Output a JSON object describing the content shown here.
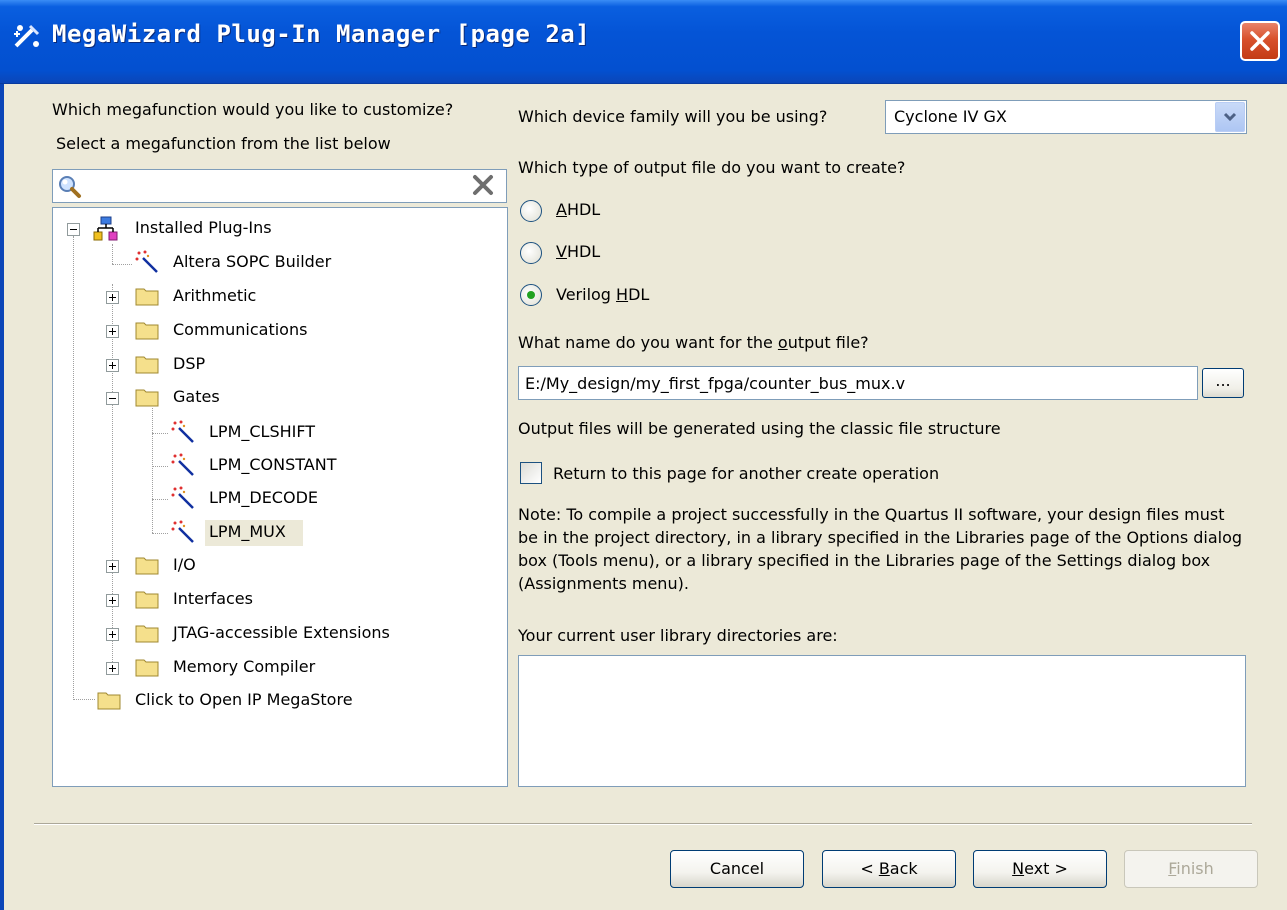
{
  "window": {
    "title": "MegaWizard Plug-In Manager [page 2a]"
  },
  "left": {
    "question": "Which megafunction would you like to customize?",
    "instruction": "Select a megafunction from the list below",
    "search_placeholder": "",
    "tree": {
      "root": "Installed Plug-Ins",
      "items": [
        "Altera SOPC Builder",
        "Arithmetic",
        "Communications",
        "DSP",
        "Gates",
        "LPM_CLSHIFT",
        "LPM_CONSTANT",
        "LPM_DECODE",
        "LPM_MUX",
        "I/O",
        "Interfaces",
        "JTAG-accessible Extensions",
        "Memory Compiler",
        "Click to Open IP MegaStore"
      ],
      "selected": "LPM_MUX"
    }
  },
  "right": {
    "device_question": "Which device family will you be using?",
    "device_value": "Cyclone IV GX",
    "output_type_question": "Which type of output file do you want to create?",
    "radio_options": {
      "ahdl_first": "A",
      "ahdl_rest": "HDL",
      "vhdl_first": "V",
      "vhdl_rest": "HDL",
      "verilog_pre": "Verilog ",
      "verilog_key": "H",
      "verilog_rest": "DL"
    },
    "selected_output": "Verilog HDL",
    "name_question_pre": "What name do you want for the ",
    "name_question_key": "o",
    "name_question_rest": "utput file?",
    "output_file_value": "E:/My_design/my_first_fpga/counter_bus_mux.v",
    "browse_label": "...",
    "structure_note": "Output files will be generated using the classic file structure",
    "return_checkbox_label": "Return to this page for another create operation",
    "return_checked": false,
    "note": "Note: To compile a project successfully in the Quartus II software, your design files must be in the project directory, in a library specified in the Libraries page of the Options dialog box (Tools menu), or a library specified in the Libraries page of the Settings dialog box (Assignments menu).",
    "library_label": "Your current user library directories are:"
  },
  "buttons": {
    "cancel": "Cancel",
    "back_pre": "< ",
    "back_key": "B",
    "back_rest": "ack",
    "next_key": "N",
    "next_rest": "ext >",
    "finish_key": "F",
    "finish_rest": "inish"
  },
  "colors": {
    "title_bar": "#0454d6",
    "dialog_bg": "#ece9d8",
    "radio_selected": "#21a121",
    "close_button": "#d8512c"
  },
  "icons": {
    "app": "megawizard-wand-icon",
    "close": "close-icon",
    "search": "search-icon",
    "clear": "clear-search-icon",
    "plugin_root": "installed-plugins-icon",
    "folder": "folder-icon",
    "wand": "megafunction-wand-icon",
    "dropdown": "chevron-down-icon"
  }
}
